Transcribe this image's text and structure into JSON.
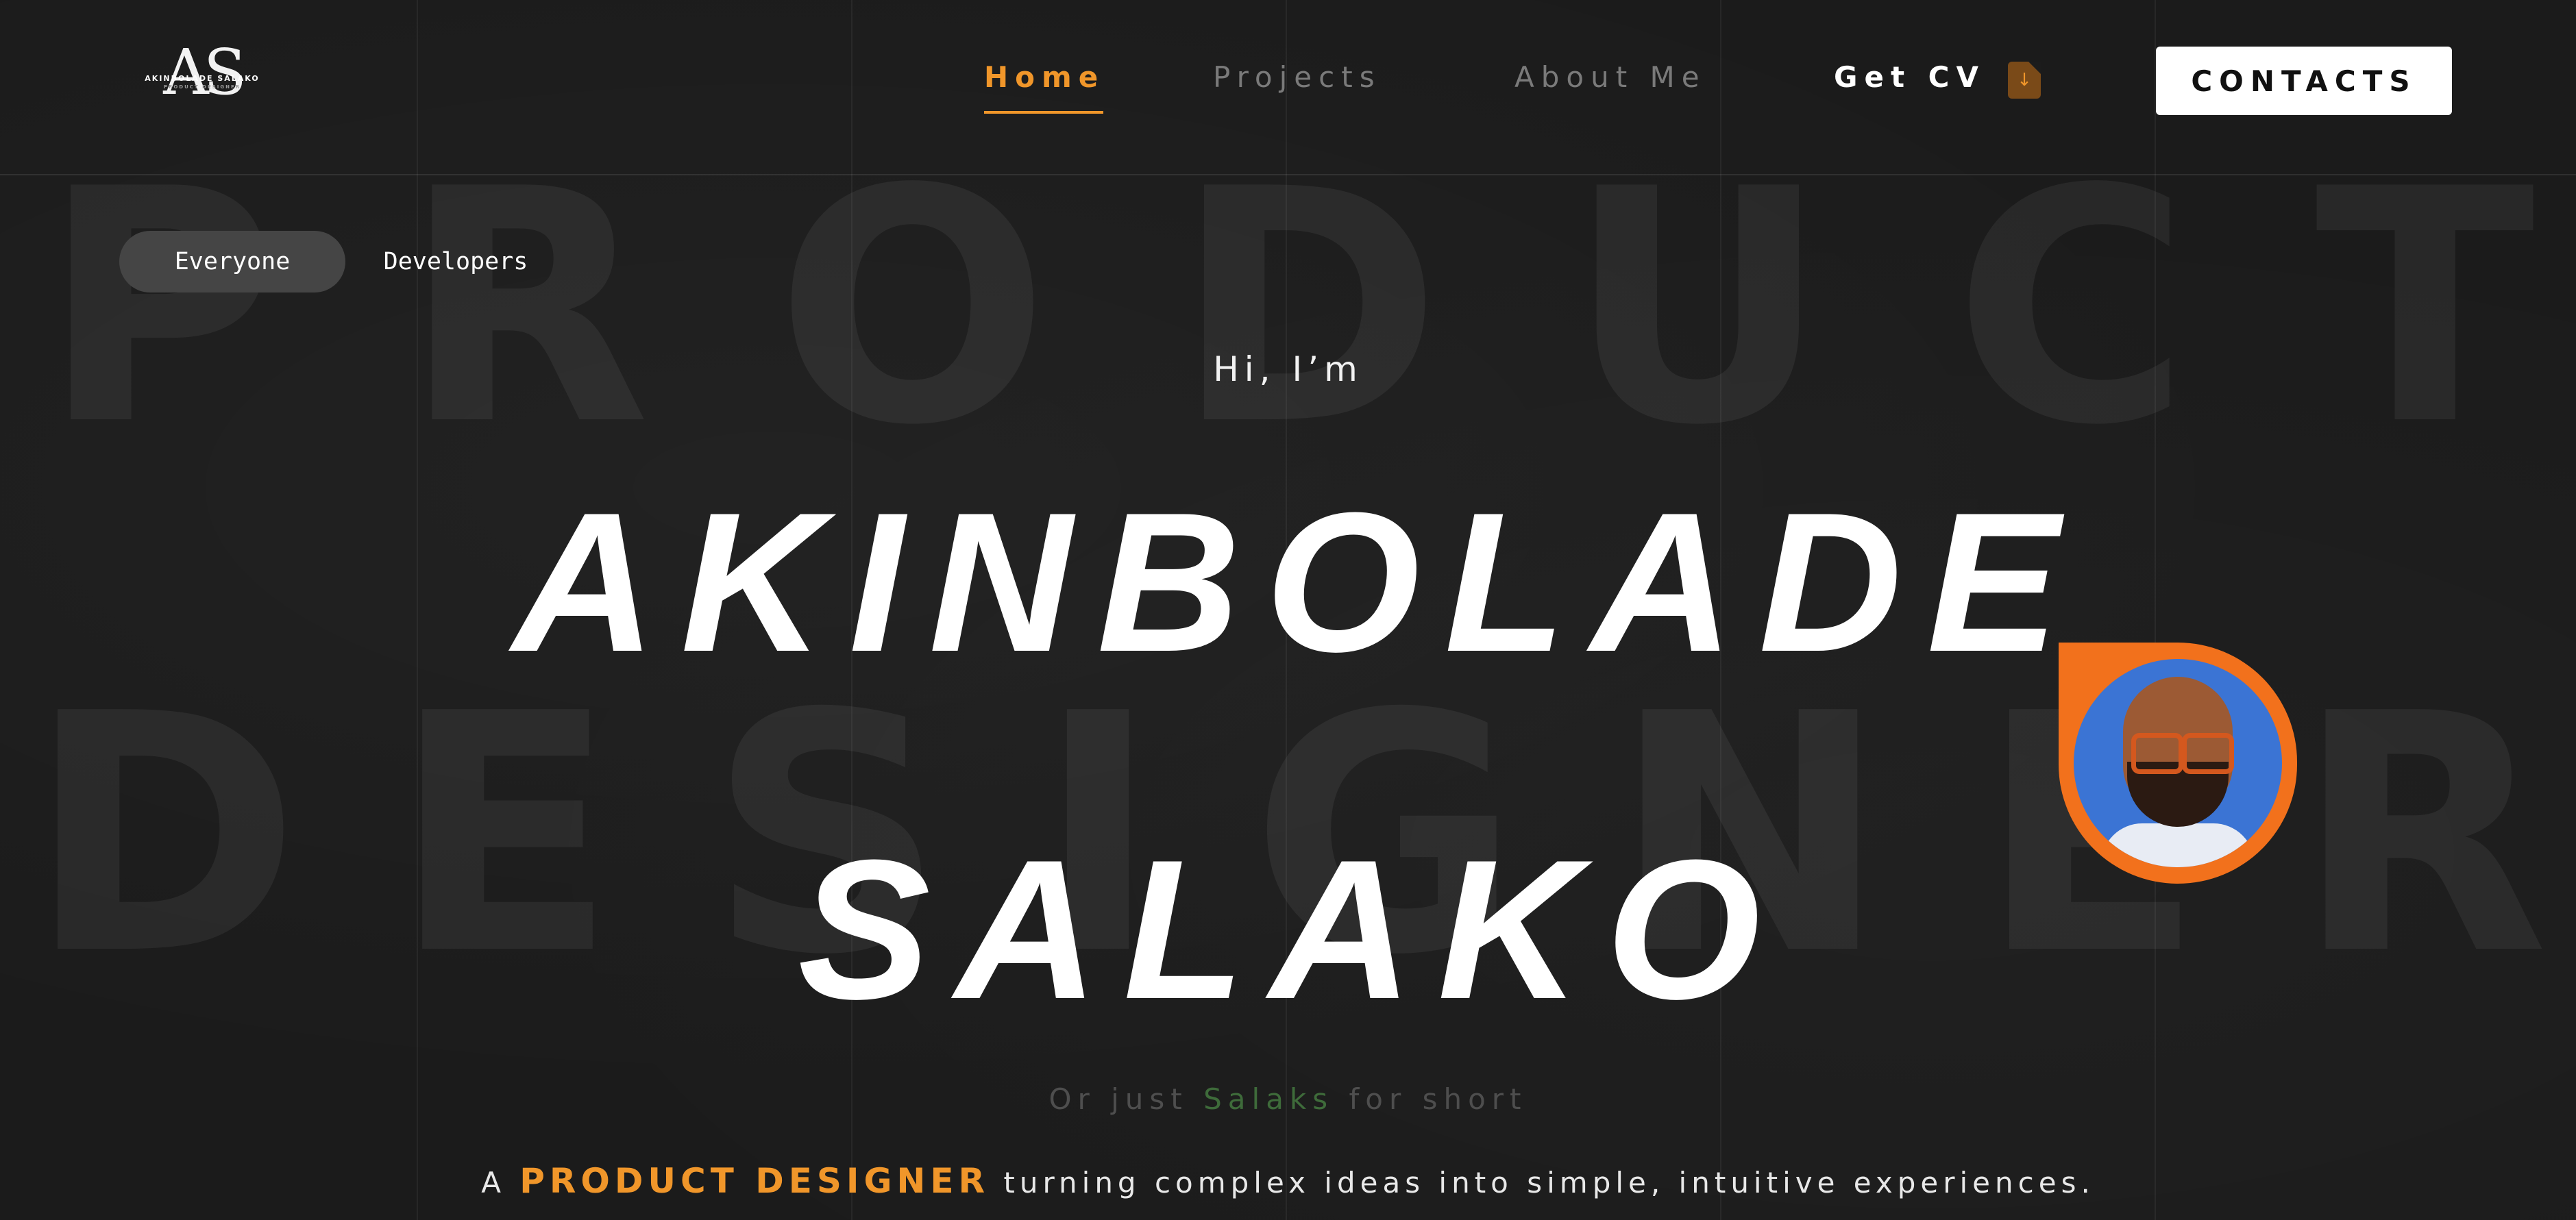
{
  "logo": {
    "monogram": "AS",
    "name": "AKINBOLADE SALAKO",
    "subtitle": "PRODUCT DESIGNER"
  },
  "nav": {
    "home": "Home",
    "projects": "Projects",
    "about": "About Me",
    "cv": "Get CV",
    "contacts": "CONTACTS"
  },
  "toggle": {
    "everyone": "Everyone",
    "developers": "Developers"
  },
  "watermark": {
    "line1": [
      "P",
      "R",
      "O",
      "D",
      "U",
      "C",
      "T"
    ],
    "line2": [
      "D",
      "E",
      "S",
      "I",
      "G",
      "N",
      "E",
      "R"
    ]
  },
  "hero": {
    "greeting": "Hi, I’m",
    "first_name": "AKINBOLADE",
    "last_name": "SALAKO",
    "short_prefix": "Or just ",
    "short_name": "Salaks",
    "short_suffix": " for short",
    "tagline_prefix": "A ",
    "tagline_highlight": "PRODUCT DESIGNER",
    "tagline_suffix": " turning complex ideas into simple, intuitive experiences."
  },
  "colors": {
    "accent": "#f0962a",
    "avatar_ring": "#f2711c",
    "background": "#1c1c1c",
    "salaks_green": "#3e6b3a"
  }
}
